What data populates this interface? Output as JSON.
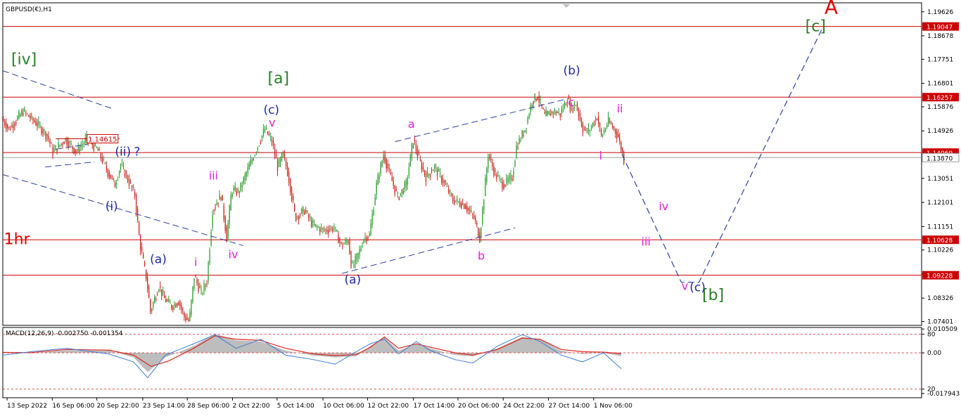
{
  "chart_data": [
    {
      "type": "line",
      "symbol": "GBPUSD(€),H1",
      "y_ticks": [
        "1.19626",
        "1.18678",
        "1.17751",
        "1.16801",
        "1.15876",
        "1.14926",
        "1.13978",
        "1.13051",
        "1.12101",
        "1.11151",
        "1.10226",
        "1.09278",
        "1.08326",
        "1.07401"
      ],
      "ylim": [
        1.0725,
        1.1998
      ],
      "x_tick_labels": [
        "13 Sep 2022",
        "16 Sep 06:00",
        "20 Sep 22:00",
        "23 Sep 14:00",
        "28 Sep 06:00",
        "2 Oct 22:00",
        "5 Oct 14:00",
        "10 Oct 06:00",
        "12 Oct 22:00",
        "17 Oct 14:00",
        "20 Oct 06:00",
        "24 Oct 22:00",
        "27 Oct 14:00",
        "1 Nov 06:00"
      ],
      "x_index_range": [
        0,
        1300
      ],
      "x_tick_index": [
        6,
        70,
        133,
        198,
        261,
        325,
        388,
        453,
        516,
        581,
        644,
        708,
        772,
        836
      ],
      "price_path": [
        [
          0,
          1.154
        ],
        [
          10,
          1.15
        ],
        [
          30,
          1.157
        ],
        [
          50,
          1.152
        ],
        [
          65,
          1.147
        ],
        [
          72,
          1.141
        ],
        [
          90,
          1.146
        ],
        [
          105,
          1.141
        ],
        [
          120,
          1.146
        ],
        [
          135,
          1.142
        ],
        [
          150,
          1.133
        ],
        [
          160,
          1.128
        ],
        [
          168,
          1.136
        ],
        [
          175,
          1.132
        ],
        [
          188,
          1.124
        ],
        [
          195,
          1.105
        ],
        [
          205,
          1.09
        ],
        [
          210,
          1.078
        ],
        [
          222,
          1.088
        ],
        [
          230,
          1.083
        ],
        [
          240,
          1.08
        ],
        [
          250,
          1.082
        ],
        [
          258,
          1.076
        ],
        [
          265,
          1.074
        ],
        [
          272,
          1.092
        ],
        [
          282,
          1.085
        ],
        [
          290,
          1.09
        ],
        [
          298,
          1.118
        ],
        [
          310,
          1.124
        ],
        [
          318,
          1.107
        ],
        [
          325,
          1.126
        ],
        [
          335,
          1.125
        ],
        [
          348,
          1.134
        ],
        [
          360,
          1.142
        ],
        [
          372,
          1.15
        ],
        [
          382,
          1.145
        ],
        [
          390,
          1.135
        ],
        [
          398,
          1.14
        ],
        [
          405,
          1.132
        ],
        [
          415,
          1.115
        ],
        [
          428,
          1.118
        ],
        [
          440,
          1.112
        ],
        [
          455,
          1.11
        ],
        [
          470,
          1.111
        ],
        [
          480,
          1.104
        ],
        [
          490,
          1.106
        ],
        [
          495,
          1.095
        ],
        [
          505,
          1.101
        ],
        [
          512,
          1.107
        ],
        [
          520,
          1.108
        ],
        [
          530,
          1.128
        ],
        [
          540,
          1.14
        ],
        [
          550,
          1.131
        ],
        [
          560,
          1.123
        ],
        [
          572,
          1.128
        ],
        [
          582,
          1.146
        ],
        [
          590,
          1.138
        ],
        [
          600,
          1.131
        ],
        [
          612,
          1.135
        ],
        [
          625,
          1.129
        ],
        [
          638,
          1.122
        ],
        [
          655,
          1.12
        ],
        [
          668,
          1.115
        ],
        [
          676,
          1.107
        ],
        [
          688,
          1.14
        ],
        [
          698,
          1.132
        ],
        [
          710,
          1.128
        ],
        [
          722,
          1.131
        ],
        [
          728,
          1.143
        ],
        [
          740,
          1.15
        ],
        [
          750,
          1.161
        ],
        [
          758,
          1.163
        ],
        [
          768,
          1.155
        ],
        [
          780,
          1.157
        ],
        [
          790,
          1.156
        ],
        [
          800,
          1.162
        ],
        [
          805,
          1.158
        ],
        [
          812,
          1.16
        ],
        [
          822,
          1.15
        ],
        [
          830,
          1.149
        ],
        [
          842,
          1.155
        ],
        [
          848,
          1.147
        ],
        [
          858,
          1.153
        ],
        [
          866,
          1.15
        ],
        [
          872,
          1.147
        ],
        [
          880,
          1.138
        ]
      ],
      "levels": [
        {
          "value": 1.19047,
          "label": "1.19047",
          "color": "#cc0000"
        },
        {
          "value": 1.16257,
          "label": "1.16257",
          "color": "#cc0000"
        },
        {
          "value": 1.14069,
          "label": "1.14069",
          "color": "#cc0000"
        },
        {
          "value": 1.10628,
          "label": "1.10628",
          "color": "#cc0000"
        },
        {
          "value": 1.09228,
          "label": "1.09228",
          "color": "#cc0000"
        }
      ],
      "current_price": {
        "value": 1.1387,
        "label": "1.13870"
      },
      "marker": {
        "value": 1.14615,
        "label": "1.14615",
        "from_index": 75,
        "to_index": 165
      },
      "trendlines": [
        {
          "points": [
            [
              0,
              1.173
            ],
            [
              155,
              1.158
            ]
          ],
          "color": "#2b3fa5"
        },
        {
          "points": [
            [
              0,
              1.132
            ],
            [
              340,
              1.104
            ]
          ],
          "color": "#2b3fa5"
        },
        {
          "points": [
            [
              75,
              1.142
            ],
            [
              120,
              1.144
            ]
          ],
          "color": "#2b3fa5"
        },
        {
          "points": [
            [
              60,
              1.135
            ],
            [
              130,
              1.137
            ]
          ],
          "color": "#2b3fa5"
        },
        {
          "points": [
            [
              480,
              1.093
            ],
            [
              725,
              1.111
            ]
          ],
          "color": "#2b3fa5"
        },
        {
          "points": [
            [
              555,
              1.145
            ],
            [
              800,
              1.162
            ]
          ],
          "color": "#2b3fa5"
        }
      ],
      "projection": {
        "points": [
          [
            876,
            1.14
          ],
          [
            960,
            1.0895
          ],
          [
            985,
            1.0895
          ],
          [
            1160,
            1.19
          ]
        ],
        "color": "#2b3fa5"
      },
      "wave_labels": [
        {
          "text": "A",
          "x": 1172,
          "y": 1.1955,
          "color": "#e00000",
          "size": 28
        },
        {
          "text": "[c]",
          "x": 1150,
          "y": 1.1885,
          "color": "#2a7d2a",
          "size": 22
        },
        {
          "text": "[iv]",
          "x": 30,
          "y": 1.1755,
          "color": "#2a7d2a",
          "size": 22
        },
        {
          "text": "[a]",
          "x": 390,
          "y": 1.168,
          "color": "#2a7d2a",
          "size": 22
        },
        {
          "text": "[b]",
          "x": 1005,
          "y": 1.0825,
          "color": "#2a7d2a",
          "size": 22
        },
        {
          "text": "(b)",
          "x": 805,
          "y": 1.1715,
          "color": "#1e2aa5",
          "size": 17
        },
        {
          "text": "(c)",
          "x": 380,
          "y": 1.156,
          "color": "#1e2aa5",
          "size": 17
        },
        {
          "text": "(c)",
          "x": 983,
          "y": 1.086,
          "color": "#1e2aa5",
          "size": 17
        },
        {
          "text": "(a)",
          "x": 495,
          "y": 1.089,
          "color": "#1e2aa5",
          "size": 17
        },
        {
          "text": "(a)",
          "x": 220,
          "y": 1.097,
          "color": "#1e2aa5",
          "size": 17
        },
        {
          "text": "(i)",
          "x": 154,
          "y": 1.118,
          "color": "#1e2aa5",
          "size": 17
        },
        {
          "text": "(ii)",
          "x": 170,
          "y": 1.1395,
          "color": "#1e2aa5",
          "size": 17
        },
        {
          "text": "?",
          "x": 190,
          "y": 1.1395,
          "color": "#1e2aa5",
          "size": 17
        },
        {
          "text": "a",
          "x": 578,
          "y": 1.1505,
          "color": "#e020d8",
          "size": 16
        },
        {
          "text": "b",
          "x": 677,
          "y": 1.0985,
          "color": "#e020d8",
          "size": 16
        },
        {
          "text": "c",
          "x": 804,
          "y": 1.159,
          "color": "#e020d8",
          "size": 16
        },
        {
          "text": "v",
          "x": 381,
          "y": 1.151,
          "color": "#e020d8",
          "size": 16
        },
        {
          "text": "iii",
          "x": 298,
          "y": 1.13,
          "color": "#e020d8",
          "size": 16
        },
        {
          "text": "iv",
          "x": 326,
          "y": 1.099,
          "color": "#e020d8",
          "size": 16
        },
        {
          "text": "i",
          "x": 273,
          "y": 1.096,
          "color": "#e020d8",
          "size": 16
        },
        {
          "text": "ii",
          "x": 873,
          "y": 1.1565,
          "color": "#e020d8",
          "size": 16
        },
        {
          "text": "i",
          "x": 846,
          "y": 1.138,
          "color": "#e020d8",
          "size": 16
        },
        {
          "text": "iv",
          "x": 935,
          "y": 1.118,
          "color": "#e020d8",
          "size": 16
        },
        {
          "text": "iii",
          "x": 910,
          "y": 1.104,
          "color": "#e020d8",
          "size": 16
        },
        {
          "text": "v",
          "x": 965,
          "y": 1.0865,
          "color": "#e020d8",
          "size": 16
        },
        {
          "text": "1hr",
          "x": 20,
          "y": 1.1045,
          "color": "#e00000",
          "size": 22
        }
      ]
    },
    {
      "type": "line",
      "title": "MACD(12,26,9) -0.002750 -0.001354",
      "y_ticks": [
        "0.010509",
        "80",
        "0.00",
        "20",
        "-0.017943"
      ],
      "ylim": [
        -0.0198,
        0.0112
      ],
      "signal_levels": [
        0.0082,
        0.0,
        -0.016
      ],
      "histogram": [
        [
          0,
          0.0003
        ],
        [
          40,
          -0.0002
        ],
        [
          90,
          0.0012
        ],
        [
          150,
          0.001
        ],
        [
          185,
          -0.002
        ],
        [
          205,
          -0.0085
        ],
        [
          230,
          -0.002
        ],
        [
          270,
          0.003
        ],
        [
          300,
          0.0085
        ],
        [
          330,
          0.0055
        ],
        [
          365,
          0.005
        ],
        [
          400,
          0.001
        ],
        [
          440,
          -0.0012
        ],
        [
          470,
          -0.002
        ],
        [
          500,
          -0.0015
        ],
        [
          520,
          0.003
        ],
        [
          540,
          0.0068
        ],
        [
          560,
          0.001
        ],
        [
          585,
          0.004
        ],
        [
          605,
          0.002
        ],
        [
          640,
          -0.001
        ],
        [
          665,
          -0.0015
        ],
        [
          700,
          0.002
        ],
        [
          735,
          0.007
        ],
        [
          760,
          0.006
        ],
        [
          790,
          0.001
        ],
        [
          820,
          -0.0005
        ],
        [
          850,
          0.0
        ],
        [
          875,
          -0.0015
        ]
      ],
      "signal_line": [
        [
          0,
          0.0002
        ],
        [
          40,
          0.0001
        ],
        [
          90,
          0.0015
        ],
        [
          150,
          0.0012
        ],
        [
          185,
          -0.001
        ],
        [
          210,
          -0.006
        ],
        [
          235,
          -0.0035
        ],
        [
          270,
          0.002
        ],
        [
          300,
          0.0075
        ],
        [
          330,
          0.006
        ],
        [
          365,
          0.0055
        ],
        [
          400,
          0.002
        ],
        [
          440,
          -0.0005
        ],
        [
          470,
          -0.0012
        ],
        [
          500,
          -0.0008
        ],
        [
          520,
          0.0025
        ],
        [
          540,
          0.007
        ],
        [
          560,
          0.002
        ],
        [
          585,
          0.004
        ],
        [
          605,
          0.0025
        ],
        [
          640,
          0.0
        ],
        [
          665,
          -0.001
        ],
        [
          700,
          0.0015
        ],
        [
          735,
          0.0065
        ],
        [
          760,
          0.006
        ],
        [
          790,
          0.0015
        ],
        [
          820,
          0.0005
        ],
        [
          850,
          0.0003
        ],
        [
          875,
          -0.0003
        ]
      ],
      "main_line": [
        [
          0,
          -0.001
        ],
        [
          40,
          0.0005
        ],
        [
          90,
          0.002
        ],
        [
          150,
          -0.0005
        ],
        [
          185,
          -0.004
        ],
        [
          205,
          -0.011
        ],
        [
          230,
          -0.001
        ],
        [
          270,
          0.004
        ],
        [
          300,
          0.008
        ],
        [
          330,
          0.002
        ],
        [
          365,
          0.006
        ],
        [
          400,
          -0.001
        ],
        [
          440,
          -0.003
        ],
        [
          470,
          -0.005
        ],
        [
          500,
          0.0005
        ],
        [
          520,
          0.004
        ],
        [
          540,
          0.006
        ],
        [
          560,
          -0.0005
        ],
        [
          585,
          0.005
        ],
        [
          605,
          0.001
        ],
        [
          640,
          -0.003
        ],
        [
          665,
          -0.0045
        ],
        [
          700,
          0.003
        ],
        [
          735,
          0.008
        ],
        [
          760,
          0.005
        ],
        [
          790,
          -0.001
        ],
        [
          820,
          -0.004
        ],
        [
          850,
          0.0
        ],
        [
          875,
          -0.007
        ]
      ]
    }
  ]
}
